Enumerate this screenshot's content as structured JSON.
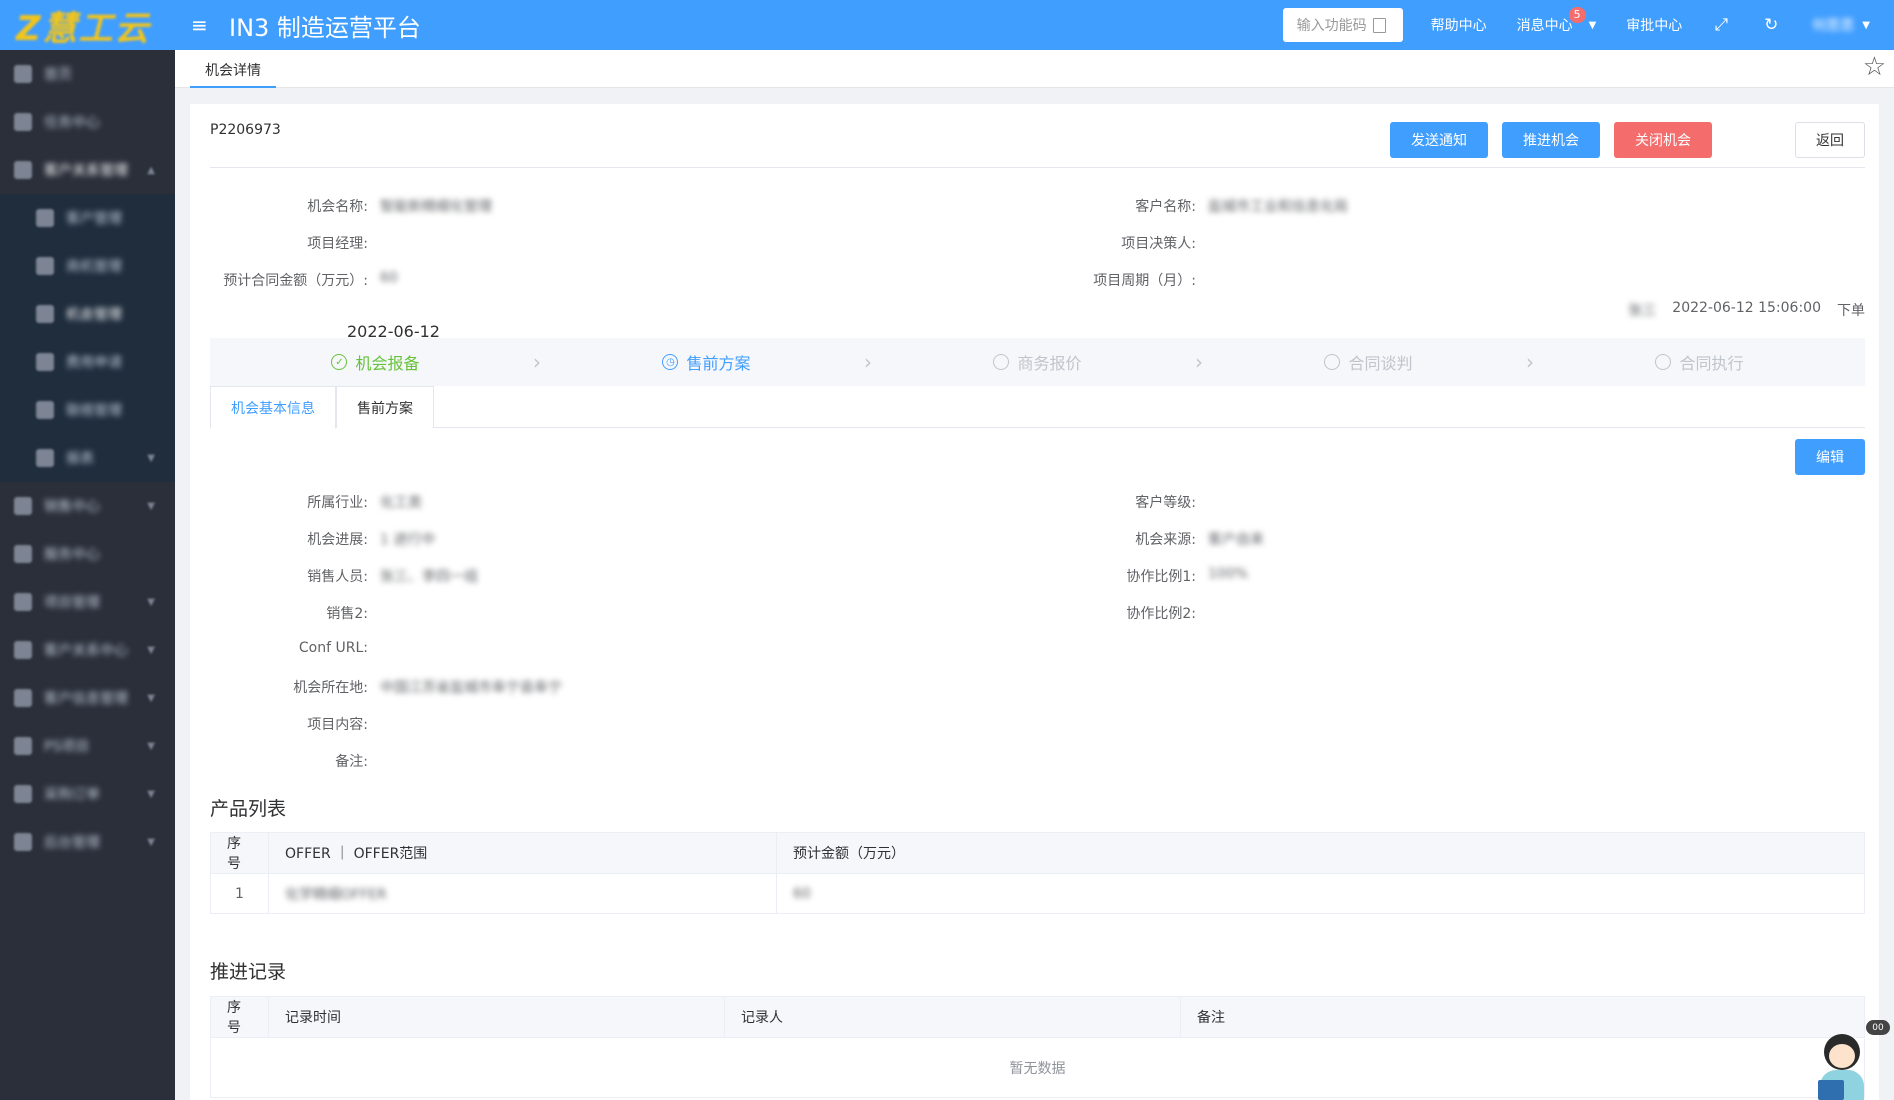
{
  "header": {
    "logo_text": "Z慧工云",
    "title": "IN3 制造运营平台",
    "code_input_placeholder": "输入功能码",
    "help": "帮助中心",
    "messages": "消息中心",
    "messages_badge": "5",
    "approval": "审批中心",
    "user": "何思思"
  },
  "sidebar": {
    "items": [
      {
        "label": "首页"
      },
      {
        "label": "任务中心"
      },
      {
        "label": "客户关系管理"
      },
      {
        "label": "客户管理"
      },
      {
        "label": "商机管理"
      },
      {
        "label": "机会管理"
      },
      {
        "label": "费用申请"
      },
      {
        "label": "联络管理"
      },
      {
        "label": "报表"
      },
      {
        "label": "销售中心"
      },
      {
        "label": "服务中心"
      },
      {
        "label": "项目管理"
      },
      {
        "label": "客户关系中心"
      },
      {
        "label": "客户信息管理"
      },
      {
        "label": "PS项目"
      },
      {
        "label": "采购订单"
      },
      {
        "label": "后台管理"
      }
    ]
  },
  "tabbar": {
    "active_tab": "机会详情"
  },
  "detail": {
    "code": "P2206973",
    "buttons": {
      "notify": "发送通知",
      "advance": "推进机会",
      "close": "关闭机会",
      "back": "返回"
    },
    "fields_left": [
      {
        "label": "机会名称:",
        "value": "智能新精细化管理"
      },
      {
        "label": "项目经理:",
        "value": ""
      },
      {
        "label": "预计合同金额（万元）:",
        "value": "60"
      }
    ],
    "fields_right": [
      {
        "label": "客户名称:",
        "value": "盐城市工业和信息化局"
      },
      {
        "label": "项目决策人:",
        "value": ""
      },
      {
        "label": "项目周期（月）:",
        "value": ""
      }
    ],
    "meta": {
      "creator": "张三",
      "datetime": "2022-06-12 15:06:00",
      "action": "下单"
    },
    "step_date": "2022-06-12",
    "steps": [
      "机会报备",
      "售前方案",
      "商务报价",
      "合同谈判",
      "合同执行"
    ],
    "tabs": [
      "机会基本信息",
      "售前方案"
    ],
    "edit": "编辑",
    "info_left": [
      {
        "label": "所属行业:",
        "value": "化工类"
      },
      {
        "label": "机会进展:",
        "value": "1 进行中"
      },
      {
        "label": "销售人员:",
        "value": "张三、李四一组"
      },
      {
        "label": "销售2:",
        "value": ""
      },
      {
        "label": "Conf URL:",
        "value": ""
      },
      {
        "label": "机会所在地:",
        "value": "中国江苏省盐城市阜宁县阜宁"
      },
      {
        "label": "项目内容:",
        "value": ""
      },
      {
        "label": "备注:",
        "value": ""
      }
    ],
    "info_right": [
      {
        "label": "客户等级:",
        "value": ""
      },
      {
        "label": "机会来源:",
        "value": "客户自来"
      },
      {
        "label": "协作比例1:",
        "value": "100%"
      },
      {
        "label": "协作比例2:",
        "value": ""
      }
    ]
  },
  "products": {
    "title": "产品列表",
    "headers": [
      "序号",
      "OFFER ｜ OFFER范围",
      "预计金额（万元）"
    ],
    "rows": [
      [
        "1",
        "化学精细OFFER",
        "60"
      ]
    ]
  },
  "records": {
    "title": "推进记录",
    "headers": [
      "序号",
      "记录时间",
      "记录人",
      "备注"
    ],
    "empty": "暂无数据"
  },
  "helper": {
    "badge": "00"
  }
}
